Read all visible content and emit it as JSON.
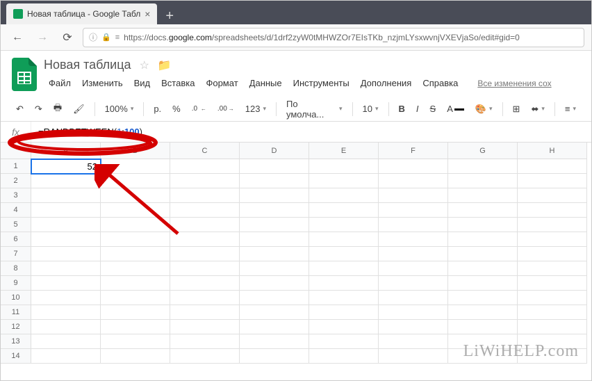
{
  "browser": {
    "tab_title": "Новая таблица - Google Табл",
    "url_prefix": "https://docs.",
    "url_bold": "google.com",
    "url_suffix": "/spreadsheets/d/1drf2zyW0tMHWZOr7EIsTKb_nzjmLYsxwvnjVXEVjaSo/edit#gid=0"
  },
  "doc": {
    "title": "Новая таблица"
  },
  "menus": {
    "file": "Файл",
    "edit": "Изменить",
    "view": "Вид",
    "insert": "Вставка",
    "format": "Формат",
    "data": "Данные",
    "tools": "Инструменты",
    "addons": "Дополнения",
    "help": "Справка",
    "changes": "Все изменения сох"
  },
  "toolbar": {
    "zoom": "100%",
    "currency": "р.",
    "percent": "%",
    "dec_dec": ".0",
    "inc_dec": ".00",
    "more_fmt": "123",
    "font": "По умолча...",
    "size": "10"
  },
  "formula": {
    "prefix": "=",
    "fn": "RANDBETWEEN",
    "open": "(",
    "arg1": "1",
    "sep": ";",
    "arg2": "100",
    "close": ")"
  },
  "grid": {
    "cols": [
      "A",
      "B",
      "C",
      "D",
      "E",
      "F",
      "G",
      "H"
    ],
    "row_count": 14,
    "cells": {
      "A1": "52"
    },
    "selected": "A1"
  },
  "watermark": "LiWiHELP.com"
}
